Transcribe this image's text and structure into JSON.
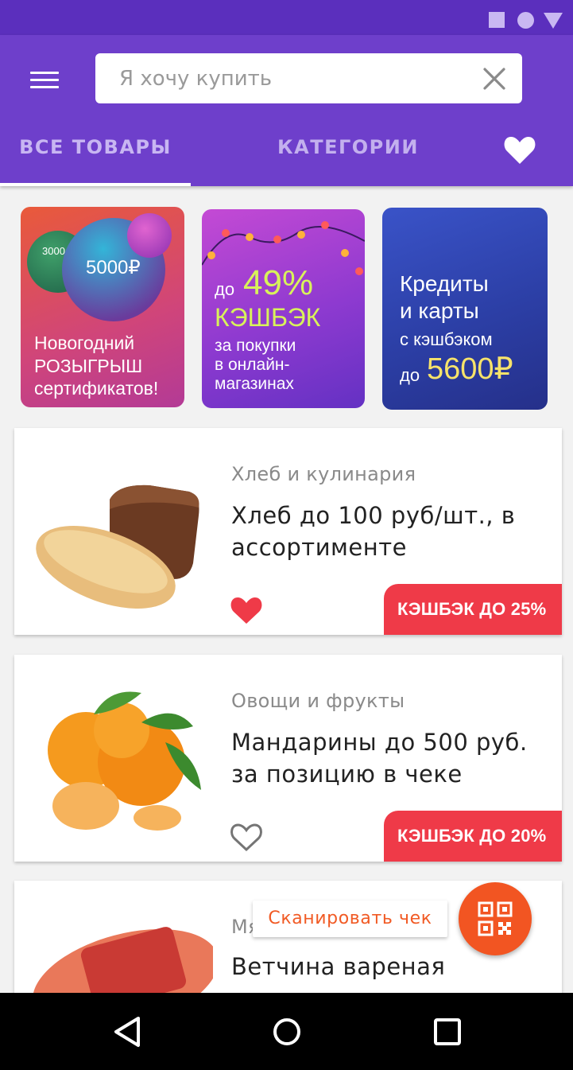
{
  "search": {
    "placeholder": "Я хочу купить"
  },
  "tabs": {
    "all": "ВСЕ ТОВАРЫ",
    "categories": "КАТЕГОРИИ"
  },
  "promos": [
    {
      "badge_small": "3000",
      "badge_big": "5000₽",
      "lines": [
        "Новогодний",
        "РОЗЫГРЫШ",
        "сертификатов!"
      ]
    },
    {
      "prefix": "до",
      "percent": "49%",
      "headline": "КЭШБЭК",
      "lines": [
        "за покупки",
        "в онлайн-",
        "магазинах"
      ]
    },
    {
      "lines": [
        "Кредиты",
        "и карты",
        "с кэшбэком"
      ],
      "prefix": "до",
      "amount": "5600₽"
    }
  ],
  "cards": [
    {
      "category": "Хлеб и кулинария",
      "title": "Хлеб до 100 руб/шт., в ассортименте",
      "favorite": true,
      "cashback": "КЭШБЭК ДО 25%"
    },
    {
      "category": "Овощи и фрукты",
      "title": "Мандарины до 500 руб. за позицию в чеке",
      "favorite": false,
      "cashback": "КЭШБЭК ДО 20%"
    },
    {
      "category": "Мясо",
      "title": "Ветчина вареная"
    }
  ],
  "scan": {
    "label": "Сканировать чек"
  },
  "colors": {
    "appbar": "#6e3fcb",
    "statusbar": "#5b2fbd",
    "badge": "#ef3a48",
    "fab": "#f25522"
  }
}
